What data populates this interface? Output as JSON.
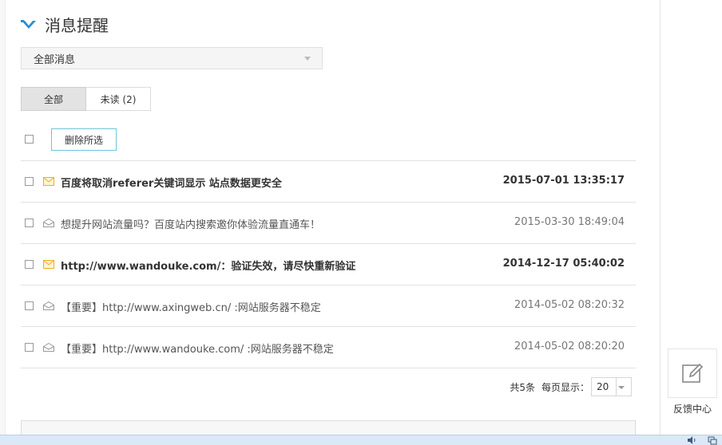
{
  "header": {
    "title": "消息提醒",
    "logo_icon": "chevron-logo-icon",
    "accent": "#2a8fd6"
  },
  "filter_dropdown": {
    "selected": "全部消息"
  },
  "tabs": [
    {
      "label": "全部",
      "active": true
    },
    {
      "label": "未读 (2)",
      "active": false
    }
  ],
  "toolbar": {
    "delete_label": "删除所选"
  },
  "messages": [
    {
      "subject": "百度将取消referer关键词显示 站点数据更安全",
      "date": "2015-07-01 13:35:17",
      "unread": true,
      "icon": "mail-unread-icon"
    },
    {
      "subject": "想提升网站流量吗？百度站内搜索邀你体验流量直通车！",
      "date": "2015-03-30 18:49:04",
      "unread": false,
      "icon": "mail-read-icon"
    },
    {
      "subject": "http://www.wandouke.com/：验证失效，请尽快重新验证",
      "date": "2014-12-17 05:40:02",
      "unread": true,
      "icon": "mail-unread-icon"
    },
    {
      "subject": "【重要】http://www.axingweb.cn/ :网站服务器不稳定",
      "date": "2014-05-02 08:20:32",
      "unread": false,
      "icon": "mail-read-icon"
    },
    {
      "subject": "【重要】http://www.wandouke.com/ :网站服务器不稳定",
      "date": "2014-05-02 08:20:20",
      "unread": false,
      "icon": "mail-read-icon"
    }
  ],
  "pager": {
    "total": "共5条",
    "per_page_label": "每页显示：",
    "per_page_value": "20"
  },
  "feedback": {
    "label": "反馈中心",
    "icon": "edit-icon"
  },
  "colors": {
    "unread_mail": "#f0ad1e",
    "read_mail": "#9a9a9a",
    "button_border": "#6cc6d8"
  }
}
